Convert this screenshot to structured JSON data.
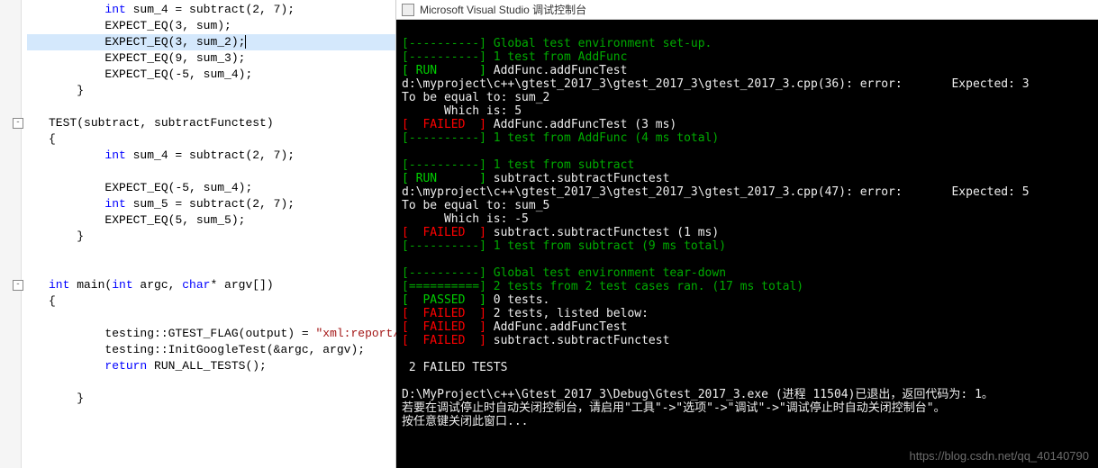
{
  "editor": {
    "lines": [
      {
        "indent": 2,
        "tokens": [
          {
            "t": "typ",
            "v": "int"
          },
          {
            "t": "",
            "v": " sum_4 = subtract(2, 7);"
          }
        ]
      },
      {
        "indent": 2,
        "tokens": [
          {
            "t": "macro",
            "v": "EXPECT_EQ"
          },
          {
            "t": "",
            "v": "(3, sum);"
          }
        ]
      },
      {
        "indent": 2,
        "highlighted": true,
        "tokens": [
          {
            "t": "macro",
            "v": "EXPECT_EQ"
          },
          {
            "t": "",
            "v": "(3, sum_2);"
          },
          {
            "t": "cursor",
            "v": ""
          }
        ]
      },
      {
        "indent": 2,
        "tokens": [
          {
            "t": "macro",
            "v": "EXPECT_EQ"
          },
          {
            "t": "",
            "v": "(9, sum_3);"
          }
        ]
      },
      {
        "indent": 2,
        "tokens": [
          {
            "t": "macro",
            "v": "EXPECT_EQ"
          },
          {
            "t": "",
            "v": "(-5, sum_4);"
          }
        ]
      },
      {
        "indent": 1,
        "tokens": [
          {
            "t": "",
            "v": "}"
          }
        ]
      },
      {
        "indent": 0,
        "tokens": []
      },
      {
        "indent": 0,
        "fold": true,
        "tokens": [
          {
            "t": "macro",
            "v": "TEST"
          },
          {
            "t": "",
            "v": "(subtract, subtractFunctest)"
          }
        ]
      },
      {
        "indent": 0,
        "tokens": [
          {
            "t": "",
            "v": "{"
          }
        ]
      },
      {
        "indent": 2,
        "tokens": [
          {
            "t": "typ",
            "v": "int"
          },
          {
            "t": "",
            "v": " sum_4 = subtract(2, 7);"
          }
        ]
      },
      {
        "indent": 0,
        "tokens": []
      },
      {
        "indent": 2,
        "tokens": [
          {
            "t": "macro",
            "v": "EXPECT_EQ"
          },
          {
            "t": "",
            "v": "(-5, sum_4);"
          }
        ]
      },
      {
        "indent": 2,
        "tokens": [
          {
            "t": "typ",
            "v": "int"
          },
          {
            "t": "",
            "v": " sum_5 = subtract(2, 7);"
          }
        ]
      },
      {
        "indent": 2,
        "tokens": [
          {
            "t": "macro",
            "v": "EXPECT_EQ"
          },
          {
            "t": "",
            "v": "(5, sum_5);"
          }
        ]
      },
      {
        "indent": 1,
        "tokens": [
          {
            "t": "",
            "v": "}"
          }
        ]
      },
      {
        "indent": 0,
        "tokens": []
      },
      {
        "indent": 0,
        "tokens": []
      },
      {
        "indent": 0,
        "fold": true,
        "tokens": [
          {
            "t": "kw",
            "v": "int"
          },
          {
            "t": "",
            "v": " main("
          },
          {
            "t": "kw",
            "v": "int"
          },
          {
            "t": "",
            "v": " argc, "
          },
          {
            "t": "kw",
            "v": "char"
          },
          {
            "t": "",
            "v": "* argv[])"
          }
        ]
      },
      {
        "indent": 0,
        "tokens": [
          {
            "t": "",
            "v": "{"
          }
        ]
      },
      {
        "indent": 0,
        "tokens": []
      },
      {
        "indent": 2,
        "tokens": [
          {
            "t": "",
            "v": "testing::"
          },
          {
            "t": "ns",
            "v": "GTEST_FLAG"
          },
          {
            "t": "",
            "v": "(output) = "
          },
          {
            "t": "str",
            "v": "\"xml:report/report"
          }
        ]
      },
      {
        "indent": 2,
        "tokens": [
          {
            "t": "",
            "v": "testing::InitGoogleTest(&argc, argv);"
          }
        ]
      },
      {
        "indent": 2,
        "tokens": [
          {
            "t": "kw",
            "v": "return"
          },
          {
            "t": "",
            "v": " RUN_ALL_TESTS();"
          }
        ]
      },
      {
        "indent": 0,
        "tokens": []
      },
      {
        "indent": 1,
        "tokens": [
          {
            "t": "",
            "v": "}"
          }
        ]
      }
    ]
  },
  "console_title": "Microsoft Visual Studio 调试控制台",
  "console": {
    "l1": "[----------] Global test environment set-up.",
    "l2": "[----------] 1 test from AddFunc",
    "l3a": "[ RUN      ]",
    "l3b": " AddFunc.addFuncTest",
    "l4": "d:\\myproject\\c++\\gtest_2017_3\\gtest_2017_3\\gtest_2017_3.cpp(36): error:       Expected: 3",
    "l5": "To be equal to: sum_2",
    "l6": "      Which is: 5",
    "l7a": "[  FAILED  ]",
    "l7b": " AddFunc.addFuncTest (3 ms)",
    "l8": "[----------] 1 test from AddFunc (4 ms total)",
    "blank1": "",
    "l9": "[----------] 1 test from subtract",
    "l10a": "[ RUN      ]",
    "l10b": " subtract.subtractFunctest",
    "l11": "d:\\myproject\\c++\\gtest_2017_3\\gtest_2017_3\\gtest_2017_3.cpp(47): error:       Expected: 5",
    "l12": "To be equal to: sum_5",
    "l13": "      Which is: -5",
    "l14a": "[  FAILED  ]",
    "l14b": " subtract.subtractFunctest (1 ms)",
    "l15": "[----------] 1 test from subtract (9 ms total)",
    "blank2": "",
    "l16": "[----------] Global test environment tear-down",
    "l17": "[==========] 2 tests from 2 test cases ran. (17 ms total)",
    "l18a": "[  PASSED  ]",
    "l18b": " 0 tests.",
    "l19a": "[  FAILED  ]",
    "l19b": " 2 tests, listed below:",
    "l20a": "[  FAILED  ]",
    "l20b": " AddFunc.addFuncTest",
    "l21a": "[  FAILED  ]",
    "l21b": " subtract.subtractFunctest",
    "blank3": "",
    "l22": " 2 FAILED TESTS",
    "blank4": "",
    "l23": "D:\\MyProject\\c++\\Gtest_2017_3\\Debug\\Gtest_2017_3.exe (进程 11504)已退出，返回代码为: 1。",
    "l24": "若要在调试停止时自动关闭控制台，请启用\"工具\"->\"选项\"->\"调试\"->\"调试停止时自动关闭控制台\"。",
    "l25": "按任意键关闭此窗口..."
  },
  "watermark": "https://blog.csdn.net/qq_40140790"
}
